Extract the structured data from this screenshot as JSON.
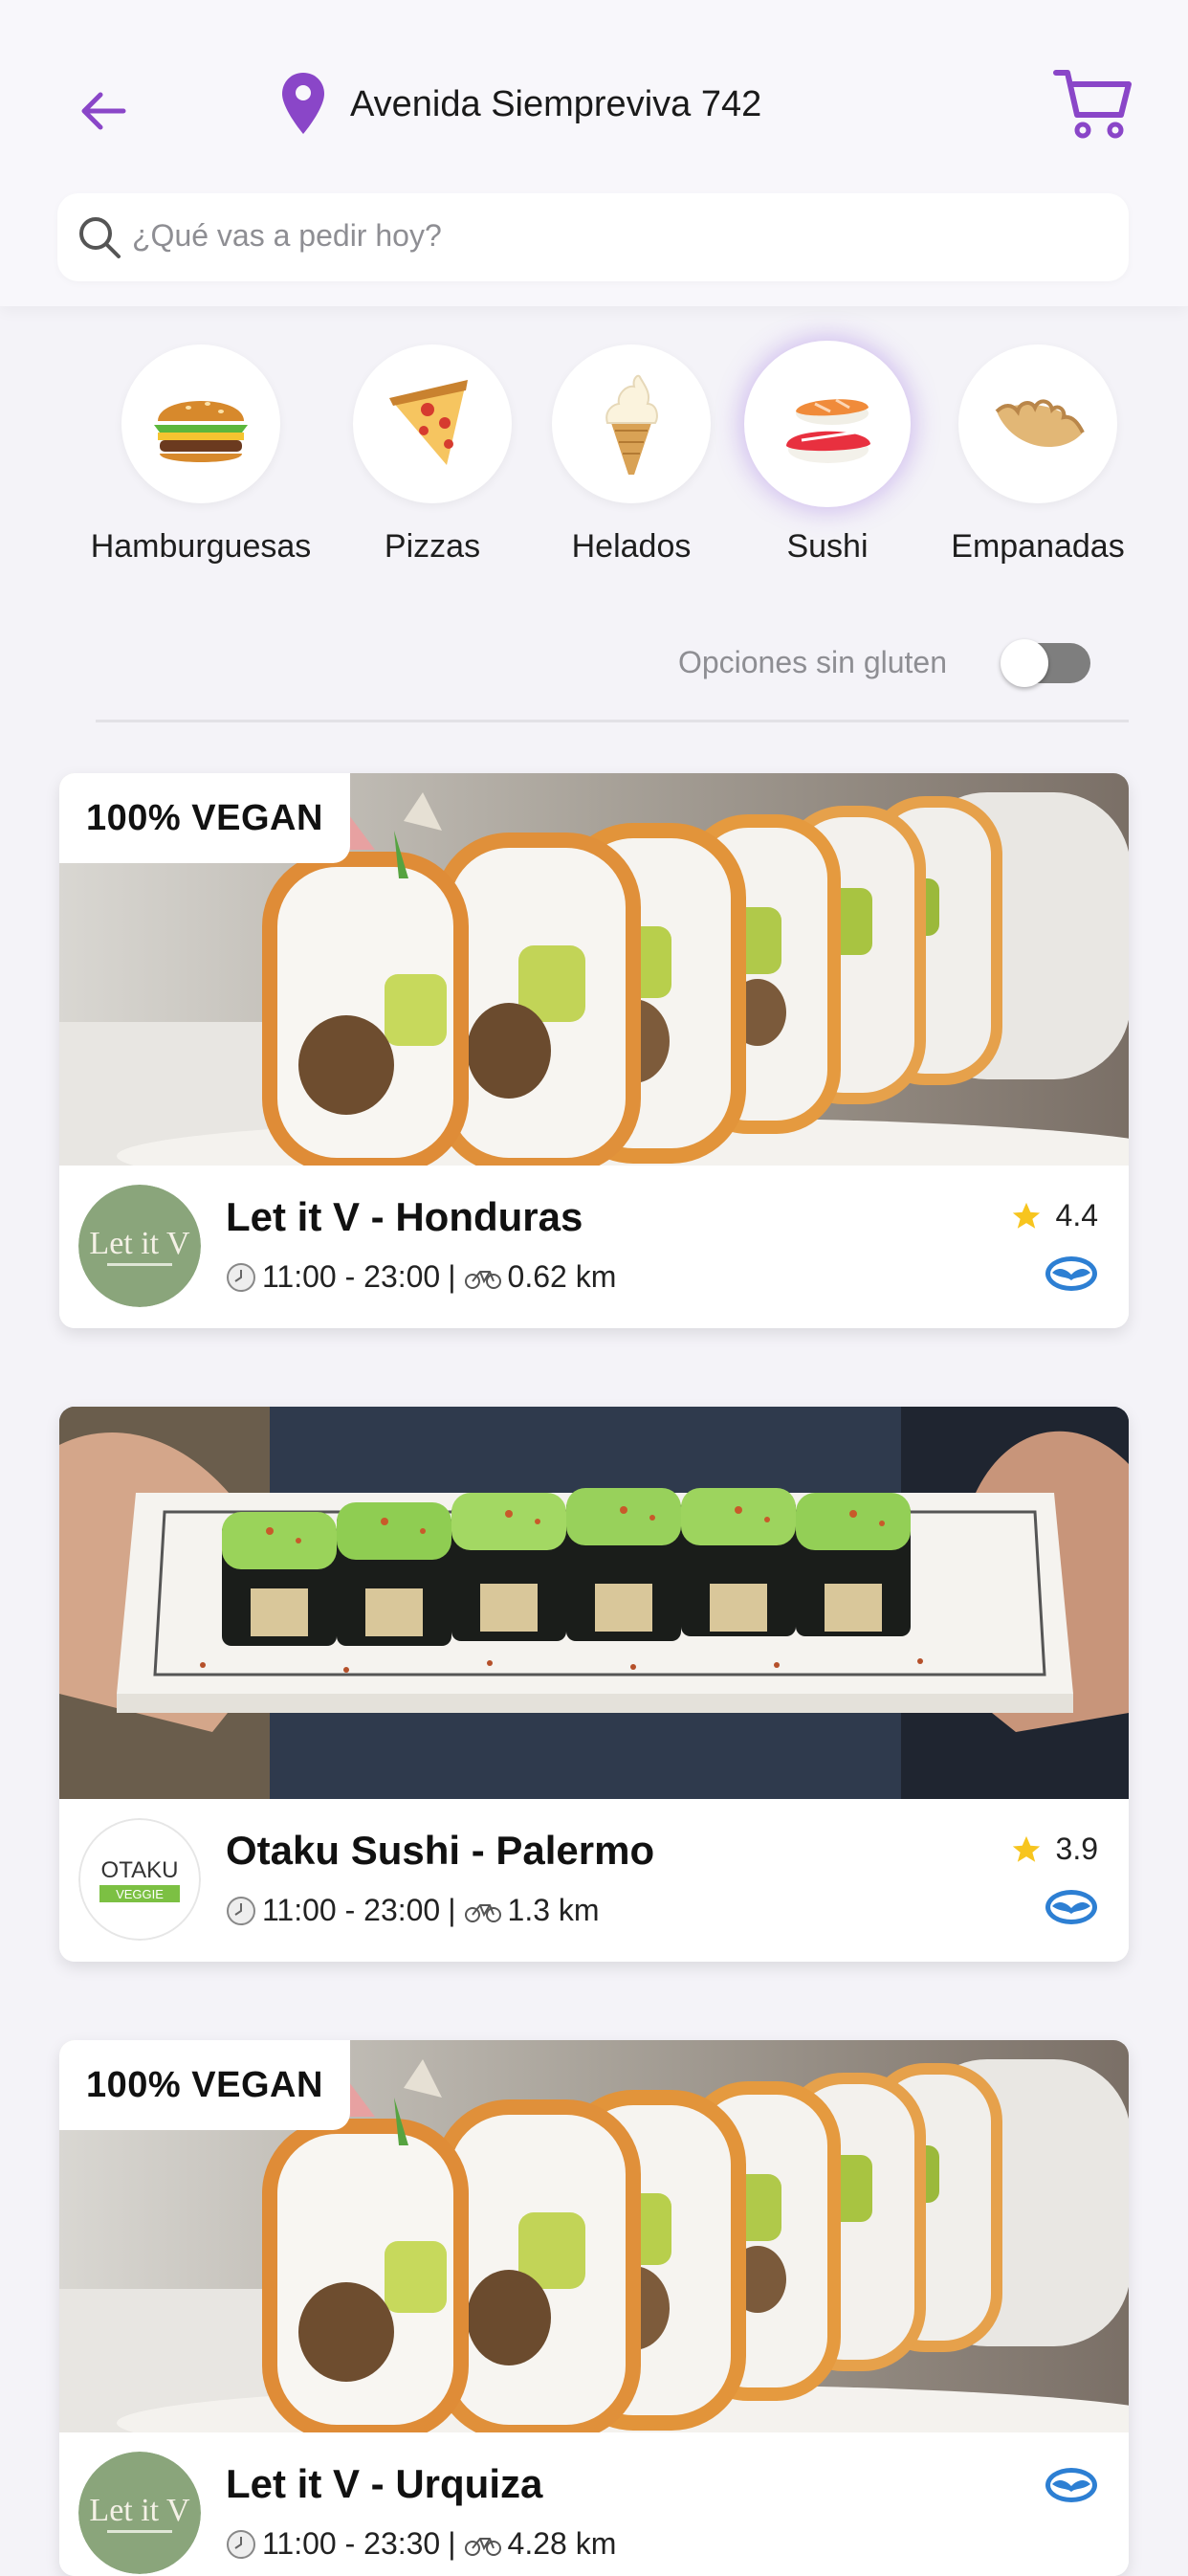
{
  "header": {
    "address": "Avenida Siempreviva 742",
    "search_placeholder": "¿Qué vas a pedir hoy?"
  },
  "categories": [
    {
      "label": "Hamburguesas",
      "icon": "burger-icon",
      "selected": false
    },
    {
      "label": "Pizzas",
      "icon": "pizza-icon",
      "selected": false
    },
    {
      "label": "Helados",
      "icon": "ice-cream-icon",
      "selected": false
    },
    {
      "label": "Sushi",
      "icon": "sushi-icon",
      "selected": true
    },
    {
      "label": "Empanadas",
      "icon": "empanada-icon",
      "selected": false
    }
  ],
  "filters": {
    "gluten_free_label": "Opciones sin gluten",
    "gluten_free_on": false
  },
  "restaurants": [
    {
      "badge": "100% VEGAN",
      "name": "Let it V - Honduras",
      "hours": "11:00 - 23:00",
      "distance": "0.62 km",
      "rating": "4.4",
      "logo_text": "Let it V",
      "photo": "sushi-rolls-photo"
    },
    {
      "badge": "",
      "name": "Otaku Sushi - Palermo",
      "hours": "11:00 - 23:00",
      "distance": "1.3 km",
      "rating": "3.9",
      "logo_text": "OTAKU",
      "logo_subtext": "VEGGIE",
      "photo": "sushi-plate-photo"
    },
    {
      "badge": "100% VEGAN",
      "name": "Let it V - Urquiza",
      "hours": "11:00 - 23:30",
      "distance": "4.28 km",
      "rating": "",
      "logo_text": "Let it V",
      "photo": "sushi-rolls-photo"
    }
  ],
  "colors": {
    "accent": "#8a46c8",
    "star": "#f7c51e",
    "pay": "#2d7fd3"
  },
  "separator": "|"
}
